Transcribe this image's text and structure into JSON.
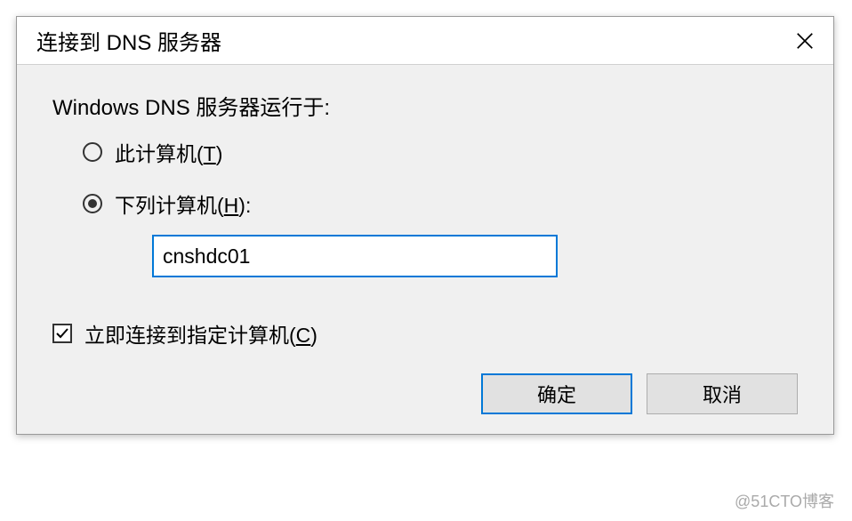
{
  "dialog": {
    "title": "连接到 DNS 服务器",
    "section_label": "Windows DNS 服务器运行于:",
    "radio_this_computer": "此计算机",
    "radio_this_computer_mnemonic": "T",
    "radio_following_computer": "下列计算机",
    "radio_following_computer_mnemonic": "H",
    "radio_following_computer_suffix": ":",
    "computer_name_value": "cnshdc01",
    "checkbox_connect_now": "立即连接到指定计算机",
    "checkbox_connect_now_mnemonic": "C",
    "ok_label": "确定",
    "cancel_label": "取消"
  },
  "watermark": "@51CTO博客"
}
